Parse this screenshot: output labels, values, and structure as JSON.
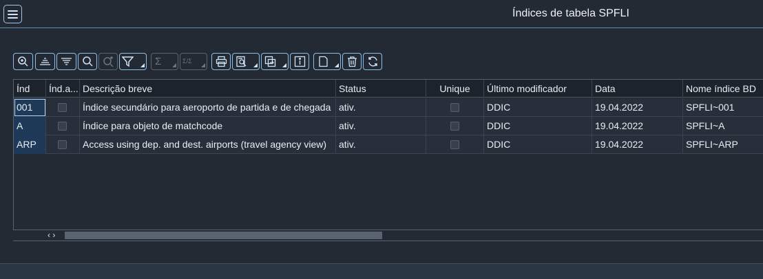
{
  "window": {
    "title": "Índices de tabela SPFLI"
  },
  "toolbar": {
    "buttons": [
      {
        "name": "details-button",
        "icon": "magnifier-detail-icon",
        "enabled": true
      },
      {
        "name": "sort-ascending-button",
        "icon": "sort-ascending-icon",
        "enabled": true
      },
      {
        "name": "sort-descending-button",
        "icon": "sort-descending-icon",
        "enabled": true
      },
      {
        "name": "find-button",
        "icon": "search-icon",
        "enabled": true
      },
      {
        "name": "find-next-button",
        "icon": "search-plus-icon",
        "enabled": false
      },
      {
        "name": "filter-button",
        "icon": "filter-icon",
        "enabled": true,
        "dropdown": true
      },
      {
        "name": "total-button",
        "icon": "sigma-icon",
        "enabled": false,
        "dropdown": true
      },
      {
        "name": "subtotal-button",
        "icon": "subtotal-icon",
        "enabled": false,
        "dropdown": true
      },
      {
        "name": "print-button",
        "icon": "printer-icon",
        "enabled": true
      },
      {
        "name": "print-preview-button",
        "icon": "print-preview-icon",
        "enabled": true,
        "dropdown": true
      },
      {
        "name": "export-button",
        "icon": "export-icon",
        "enabled": true,
        "dropdown": true
      },
      {
        "name": "info-button",
        "icon": "info-icon",
        "enabled": true
      },
      {
        "name": "layout-button",
        "icon": "document-icon",
        "enabled": true,
        "dropdown": true
      },
      {
        "name": "delete-button",
        "icon": "trash-icon",
        "enabled": true
      },
      {
        "name": "refresh-button",
        "icon": "refresh-icon",
        "enabled": true
      }
    ],
    "sigma_glyph": "Σ",
    "subtotal_glyph": "Σ/Σ"
  },
  "table": {
    "columns": [
      "Índ",
      "Índ.a...",
      "Descrição breve",
      "Status",
      "Unique",
      "Último modificador",
      "Data",
      "Nome índice BD"
    ],
    "rows": [
      {
        "ind": "001",
        "desc": "Índice secundário para aeroporto de partida e de chegada",
        "status": "ativ.",
        "modifier": "DDIC",
        "date": "19.04.2022",
        "dbname": "SPFLI~001"
      },
      {
        "ind": "A",
        "desc": "Índice para objeto de matchcode",
        "status": "ativ.",
        "modifier": "DDIC",
        "date": "19.04.2022",
        "dbname": "SPFLI~A"
      },
      {
        "ind": "ARP",
        "desc": "Access using dep. and dest. airports (travel agency view)",
        "status": "ativ.",
        "modifier": "DDIC",
        "date": "19.04.2022",
        "dbname": "SPFLI~ARP"
      }
    ]
  },
  "scrollbar": {
    "arrows": "‹ ›"
  }
}
